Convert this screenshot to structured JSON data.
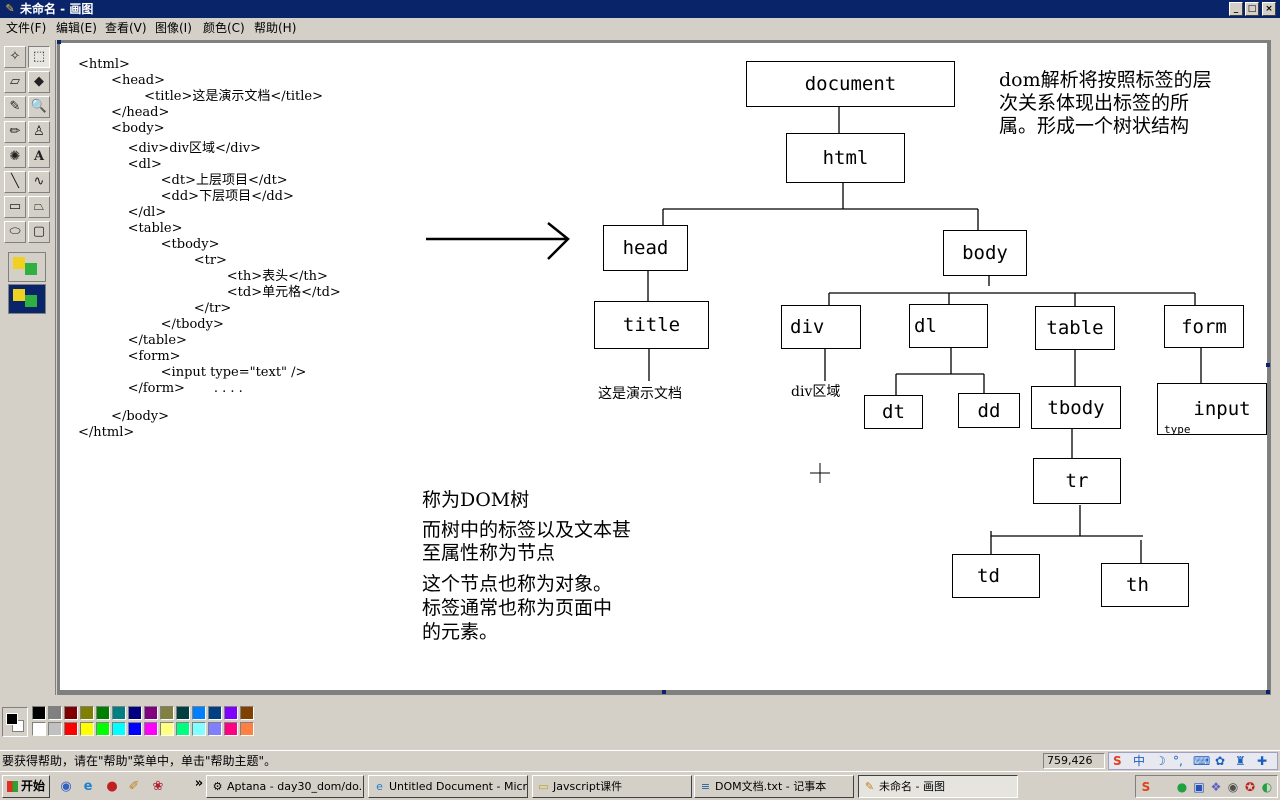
{
  "window": {
    "title": "未命名 - 画图",
    "min": "_",
    "max": "□",
    "close": "×"
  },
  "menu": [
    "文件(F)",
    "编辑(E)",
    "查看(V)",
    "图像(I)",
    "颜色(C)",
    "帮助(H)"
  ],
  "tools": [
    {
      "name": "free-select-tool",
      "glyph": "✧"
    },
    {
      "name": "rect-select-tool",
      "glyph": "⬚"
    },
    {
      "name": "eraser-tool",
      "glyph": "▱"
    },
    {
      "name": "fill-tool",
      "glyph": "◆"
    },
    {
      "name": "color-picker-tool",
      "glyph": "✎"
    },
    {
      "name": "magnifier-tool",
      "glyph": "🔍"
    },
    {
      "name": "pencil-tool",
      "glyph": "✏"
    },
    {
      "name": "brush-tool",
      "glyph": "♙"
    },
    {
      "name": "airbrush-tool",
      "glyph": "✺"
    },
    {
      "name": "text-tool",
      "glyph": "A"
    },
    {
      "name": "line-tool",
      "glyph": "╲"
    },
    {
      "name": "curve-tool",
      "glyph": "∿"
    },
    {
      "name": "rectangle-tool",
      "glyph": "▭"
    },
    {
      "name": "polygon-tool",
      "glyph": "⏢"
    },
    {
      "name": "ellipse-tool",
      "glyph": "⬭"
    },
    {
      "name": "rounded-rect-tool",
      "glyph": "▢"
    }
  ],
  "code": [
    "<html>",
    "        <head>",
    "                <title>这是演示文档</title>",
    "        </head>",
    "        <body>",
    "            <div>div区域</div>",
    "            <dl>",
    "                    <dt>上层项目</dt>",
    "                    <dd>下层项目</dd>",
    "            </dl>",
    "            <table>",
    "                    <tbody>",
    "                            <tr>",
    "                                    <th>表头</th>",
    "                                    <td>单元格</td>",
    "                            </tr>",
    "                    </tbody>",
    "            </table>",
    "            <form>",
    "                    <input type=\"text\" />",
    "            </form>       . . . .",
    "",
    "        </body>",
    "</html>"
  ],
  "tree": {
    "document": "document",
    "html": "html",
    "head": "head",
    "body": "body",
    "title": "title",
    "div": "div",
    "dl": "dl",
    "table": "table",
    "form": "form",
    "dt": "dt",
    "dd": "dd",
    "tbody": "tbody",
    "input": "input",
    "input_type": "type",
    "tr": "tr",
    "td": "td",
    "th": "th",
    "title_text": "这是演示文档",
    "div_text": "div区域"
  },
  "notes": {
    "top_right": [
      "dom解析将按照标签的层",
      "次关系体现出标签的所",
      "属。形成一个树状结构"
    ],
    "bottom": [
      "称为DOM树",
      "而树中的标签以及文本甚",
      "至属性称为节点",
      "这个节点也称为对象。",
      "标签通常也称为页面中",
      "的元素。"
    ]
  },
  "palette": {
    "top": [
      "#000000",
      "#808080",
      "#800000",
      "#808000",
      "#008000",
      "#008080",
      "#000080",
      "#800080",
      "#808040",
      "#004040",
      "#0080ff",
      "#004080",
      "#8000ff",
      "#804000"
    ],
    "bottom": [
      "#ffffff",
      "#c0c0c0",
      "#ff0000",
      "#ffff00",
      "#00ff00",
      "#00ffff",
      "#0000ff",
      "#ff00ff",
      "#ffff80",
      "#00ff80",
      "#80ffff",
      "#8080ff",
      "#ff0080",
      "#ff8040"
    ]
  },
  "status": {
    "help": "要获得帮助，请在\"帮助\"菜单中，单击\"帮助主题\"。",
    "coords": "759,426"
  },
  "ime": {
    "logo": "S",
    "mode": "中"
  },
  "taskbar": {
    "start": "开始",
    "quick_launch": [
      "◉",
      "e",
      "●",
      "✐",
      "❀",
      "»"
    ],
    "tasks": [
      {
        "label": "Aptana - day30_dom/do...",
        "icon": "⚙"
      },
      {
        "label": "Untitled Document - Micr...",
        "icon": "e"
      },
      {
        "label": "Javscript课件",
        "icon": "▭"
      },
      {
        "label": "DOM文档.txt - 记事本",
        "icon": "≡"
      },
      {
        "label": "未命名 - 画图",
        "icon": "✎"
      }
    ]
  }
}
